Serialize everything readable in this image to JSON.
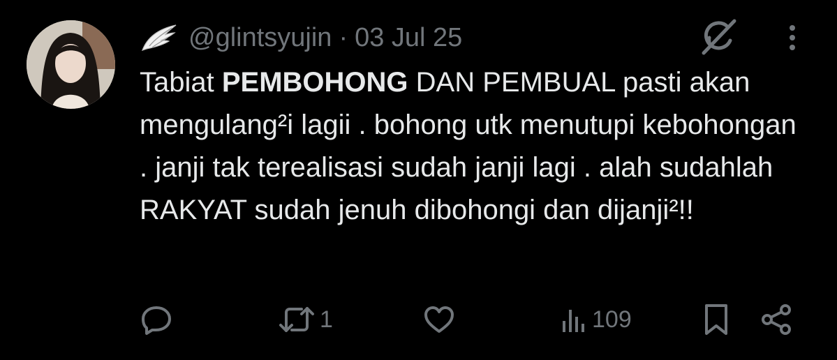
{
  "tweet": {
    "handle": "@glintsyujin",
    "separator": "·",
    "date": "03 Jul 25",
    "text": {
      "part1": "Tabiat ",
      "bold": "PEMBOHONG",
      "part2": " DAN PEMBUAL pasti akan mengulang²i lagii . bohong utk menutupi kebohongan . janji tak terealisasi sudah janji lagi . alah sudahlah RAKYAT sudah jenuh dibohongi dan dijanji²!!"
    },
    "actions": {
      "reply_count": "",
      "retweet_count": "1",
      "like_count": "",
      "views_count": "109"
    }
  },
  "icons": {
    "name_badge": "wing-icon",
    "top_right_1": "grok-icon",
    "top_right_2": "more-vertical-icon",
    "reply": "reply-icon",
    "retweet": "retweet-icon",
    "like": "heart-icon",
    "views": "views-icon",
    "bookmark": "bookmark-icon",
    "share": "share-icon"
  },
  "colors": {
    "background": "#000000",
    "primary_text": "#e7e9ea",
    "secondary_text": "#71767b"
  }
}
